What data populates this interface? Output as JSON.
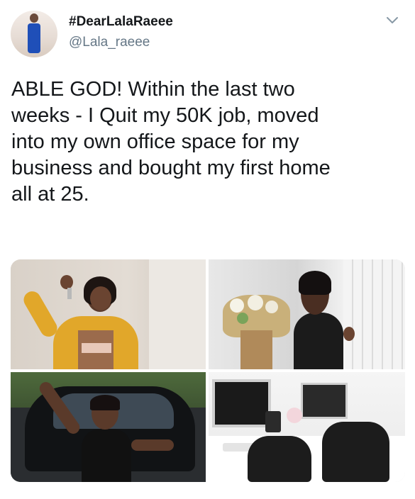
{
  "tweet": {
    "author": {
      "display_name": "#DearLalaRaeee",
      "handle": "@Lala_raeee"
    },
    "text": "ABLE GOD! Within the last two\nweeks - I Quit my 50K job, moved\ninto my own office space for my\nbusiness and bought my first home\nall at 25.",
    "menu_icon": "chevron-down-icon"
  },
  "colors": {
    "text": "#14171a",
    "secondary_text": "#657786",
    "caret": "#8899a6"
  }
}
